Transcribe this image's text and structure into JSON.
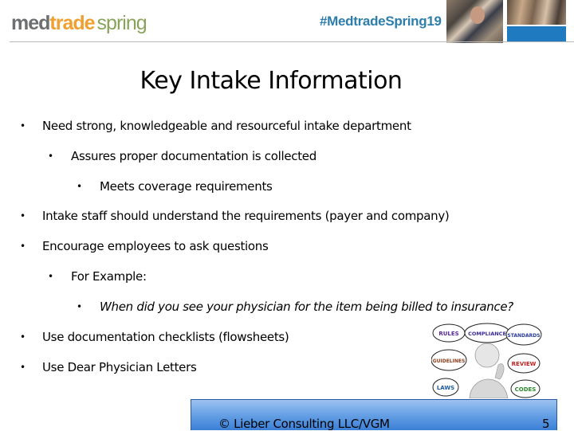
{
  "header": {
    "logo": {
      "part1": "med",
      "part2": "trade",
      "part3": "spring"
    },
    "hashtag": "#MedtradeSpring19",
    "colors": {
      "logo_gray": "#6d6e70",
      "logo_orange": "#f0a030",
      "logo_green": "#8aa35a",
      "hashtag_blue": "#2d7eac",
      "accent_blue": "#1f7ac0"
    }
  },
  "slide": {
    "title": "Key Intake Information",
    "bullets": [
      {
        "level": 1,
        "text": "Need strong, knowledgeable and resourceful intake department"
      },
      {
        "level": 2,
        "text": "Assures proper documentation is collected"
      },
      {
        "level": 3,
        "text": "Meets coverage requirements"
      },
      {
        "level": 1,
        "text": "Intake staff should understand the requirements (payer and company)"
      },
      {
        "level": 1,
        "text": "Encourage employees to ask questions"
      },
      {
        "level": 2,
        "text": "For Example:"
      },
      {
        "level": 3,
        "text": "When did you see your physician for the item being billed to insurance?",
        "italic": true
      },
      {
        "level": 1,
        "text": "Use documentation checklists (flowsheets)"
      },
      {
        "level": 1,
        "text": "Use Dear Physician Letters"
      }
    ],
    "bullet_char": "•",
    "graphic_words": [
      "RULES",
      "COMPLIANCE",
      "STANDARDS",
      "GUIDELINES",
      "REVIEW",
      "LAWS",
      "CODES"
    ]
  },
  "footer": {
    "copyright": "© Lieber Consulting LLC/VGM",
    "page_number": "5"
  }
}
